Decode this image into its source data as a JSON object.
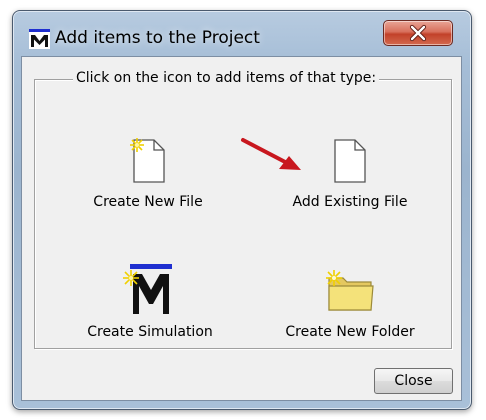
{
  "window": {
    "title": "Add items to the Project",
    "close_glyph": "X"
  },
  "group": {
    "legend": "Click on the icon to add items of that type:"
  },
  "items": [
    {
      "label": "Create New File",
      "icon": "new-file-icon"
    },
    {
      "label": "Add Existing File",
      "icon": "existing-file-icon"
    },
    {
      "label": "Create Simulation",
      "icon": "simulation-icon"
    },
    {
      "label": "Create New Folder",
      "icon": "new-folder-icon"
    }
  ],
  "annotation": {
    "icon": "red-arrow-icon",
    "color": "#c8171e"
  },
  "buttons": {
    "close": "Close"
  },
  "colors": {
    "titlebar_close": "#c2412a",
    "app_icon_bar": "#1f2fd0",
    "folder_yellow": "#f4e27a"
  }
}
